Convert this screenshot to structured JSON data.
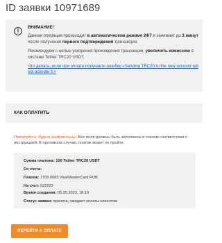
{
  "header": {
    "title": "ID заявки 10971689"
  },
  "notice": {
    "heading": "ВНИМАНИЕ!",
    "p1": {
      "t1": "Данная операция происходит ",
      "b1": "в автоматическом режиме 24/7",
      "t2": " и занимает до ",
      "b2": "3 минут",
      "t3": " после получения ",
      "b3": "первого подтверждения",
      "t4": " транзакции."
    },
    "p2": {
      "t1": "Рекомендуем с целью ускорения прохождения транзакции, ",
      "b1": "увеличить комиссию",
      "t2": " в системе Tether TRC20 USDT."
    },
    "link": "Что делать, если при оплате получаете ошибку «Sending TRC20 to the new account will not activate it.»"
  },
  "how_to_pay": {
    "label": "КАК ОПЛАТИТЬ"
  },
  "caution": {
    "lead": "Пожалуйста, будьте внимательны!",
    "text": " Все поля должны быть заполнены в точном соответствии с инструкцией. В противном случае, платеж может не пройти."
  },
  "details": {
    "amount": {
      "label": "Сумма платежа:",
      "value": "100 Tether TRC20 USDT"
    },
    "from": {
      "label": "Со счета:",
      "value": ""
    },
    "payment": {
      "label": "Платеж:",
      "value": "7709.0083 Visa/MasterCard RUB"
    },
    "to": {
      "label": "На счет:",
      "value": "522223"
    },
    "created": {
      "label": "Время создания:",
      "value": "05.05.2023, 18:19"
    },
    "status": {
      "label": "Статус заявки:",
      "value": "принята, ожидает оплаты клиентом"
    }
  },
  "actions": {
    "pay_label": "ПЕРЕЙТИ К ОПЛАТЕ"
  },
  "colors": {
    "accent": "#f08a2c",
    "panel": "#f1f1f1",
    "link": "#1f5fa6",
    "warning_text": "#e05a3a"
  },
  "icons": {
    "notice": "warning-icon"
  }
}
